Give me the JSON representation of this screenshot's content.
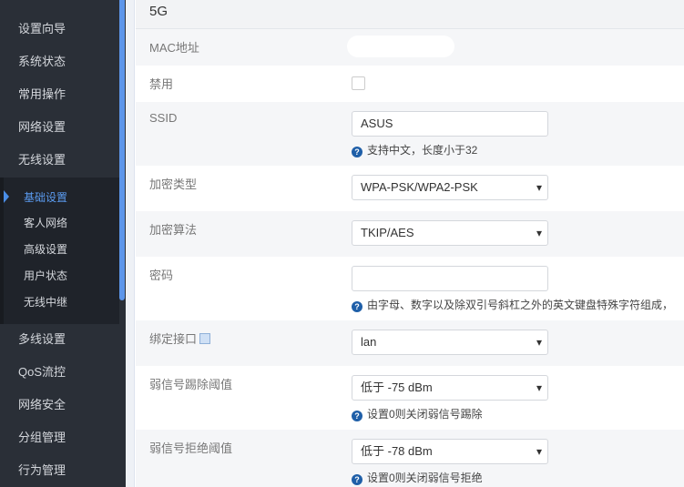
{
  "sidebar": {
    "items": [
      "设置向导",
      "系统状态",
      "常用操作",
      "网络设置",
      "无线设置"
    ],
    "sub": [
      "基础设置",
      "客人网络",
      "高级设置",
      "用户状态",
      "无线中继"
    ],
    "items2": [
      "多线设置",
      "QoS流控",
      "网络安全",
      "分组管理",
      "行为管理"
    ]
  },
  "section": "5G",
  "form": {
    "mac_label": "MAC地址",
    "disable_label": "禁用",
    "ssid_label": "SSID",
    "ssid_value": "ASUS",
    "ssid_hint": "支持中文，长度小于32",
    "enc_type_label": "加密类型",
    "enc_type_value": "WPA-PSK/WPA2-PSK",
    "enc_alg_label": "加密算法",
    "enc_alg_value": "TKIP/AES",
    "pwd_label": "密码",
    "pwd_hint": "由字母、数字以及除双引号斜杠之外的英文键盘特殊字符组成，",
    "bind_label": "绑定接口",
    "bind_value": "lan",
    "kick_label": "弱信号踢除阈值",
    "kick_value": "低于 -75 dBm",
    "kick_hint": "设置0则关闭弱信号踢除",
    "reject_label": "弱信号拒绝阈值",
    "reject_value": "低于 -78 dBm",
    "reject_hint": "设置0则关闭弱信号拒绝"
  }
}
